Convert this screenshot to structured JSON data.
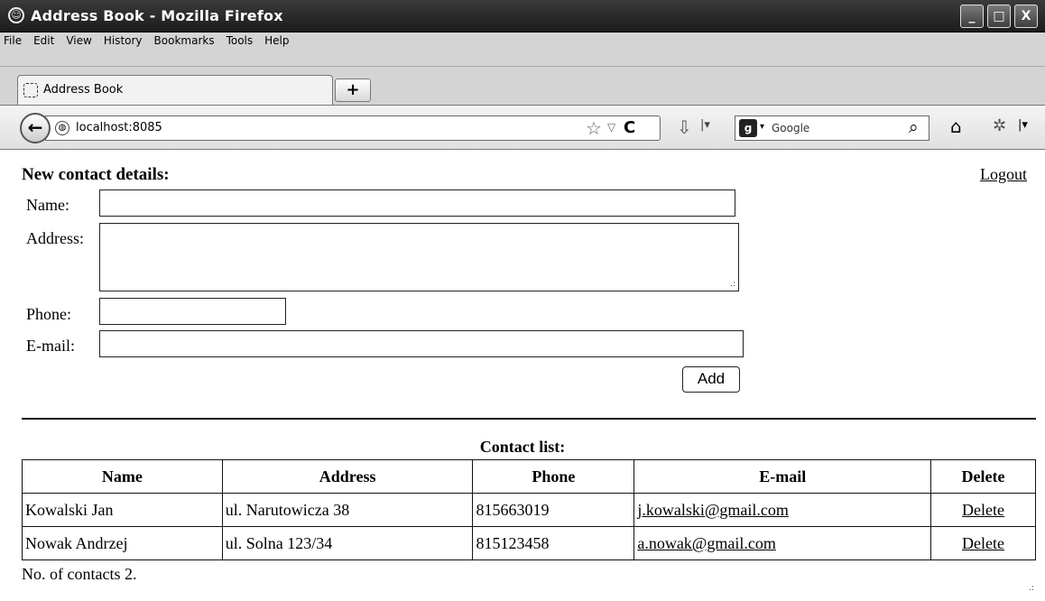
{
  "window": {
    "title": "Address Book - Mozilla Firefox",
    "controls": [
      "_",
      "□",
      "X"
    ]
  },
  "menu": [
    "File",
    "Edit",
    "View",
    "History",
    "Bookmarks",
    "Tools",
    "Help"
  ],
  "tab": {
    "label": "Address Book",
    "new_tab": "+"
  },
  "nav": {
    "back": "←",
    "url": "localhost:8085",
    "search_placeholder": "Google"
  },
  "icons": {
    "back": "arrow-left-icon",
    "site": "globe-icon",
    "bookmark": "star-icon",
    "reload": "reload-icon",
    "download": "download-icon",
    "search": "magnifier-icon",
    "home": "home-icon",
    "addon": "addon-icon"
  },
  "form": {
    "heading": "New contact details:",
    "logout": "Logout",
    "name_label": "Name:",
    "address_label": "Address:",
    "phone_label": "Phone:",
    "email_label": "E-mail:",
    "name_value": "",
    "address_value": "",
    "phone_value": "",
    "email_value": "",
    "add_label": "Add"
  },
  "contacts": {
    "caption": "Contact list:",
    "headers": [
      "Name",
      "Address",
      "Phone",
      "E-mail",
      "Delete"
    ],
    "rows": [
      {
        "name": "Kowalski Jan",
        "address": "ul. Narutowicza 38",
        "phone": "815663019",
        "email": "j.kowalski@gmail.com",
        "delete": "Delete"
      },
      {
        "name": "Nowak Andrzej",
        "address": "ul. Solna 123/34",
        "phone": "815123458",
        "email": "a.nowak@gmail.com",
        "delete": "Delete"
      }
    ],
    "count_text": "No. of contacts 2."
  }
}
